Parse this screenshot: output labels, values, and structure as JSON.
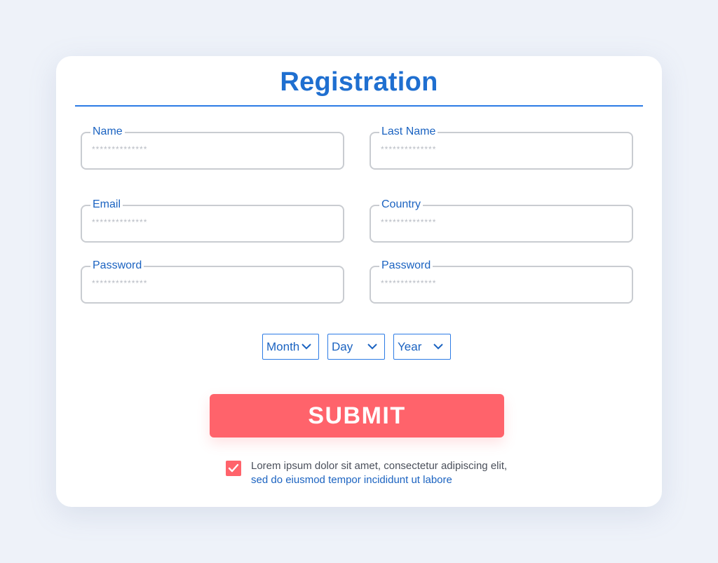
{
  "form": {
    "title": "Registration",
    "fields": [
      {
        "label": "Name",
        "placeholder": "**************"
      },
      {
        "label": "Last Name",
        "placeholder": "**************"
      },
      {
        "label": "Email",
        "placeholder": "**************"
      },
      {
        "label": "Country",
        "placeholder": "**************"
      },
      {
        "label": "Password",
        "placeholder": "**************"
      },
      {
        "label": "Password",
        "placeholder": "**************"
      }
    ],
    "dob": {
      "month": "Month",
      "day": "Day",
      "year": "Year"
    },
    "submit_label": "SUBMIT",
    "agreement": {
      "checked": true,
      "text": "Lorem ipsum dolor sit amet, consectetur adipiscing elit, ",
      "link": "sed do eiusmod tempor incididunt ut labore"
    }
  },
  "icons": {
    "dropdown": "chevron-down-icon",
    "check": "check-icon"
  },
  "colors": {
    "background": "#eef2f9",
    "accent": "#1f6fd0",
    "submit": "#ff636b",
    "field_border": "#c9ccd1"
  }
}
